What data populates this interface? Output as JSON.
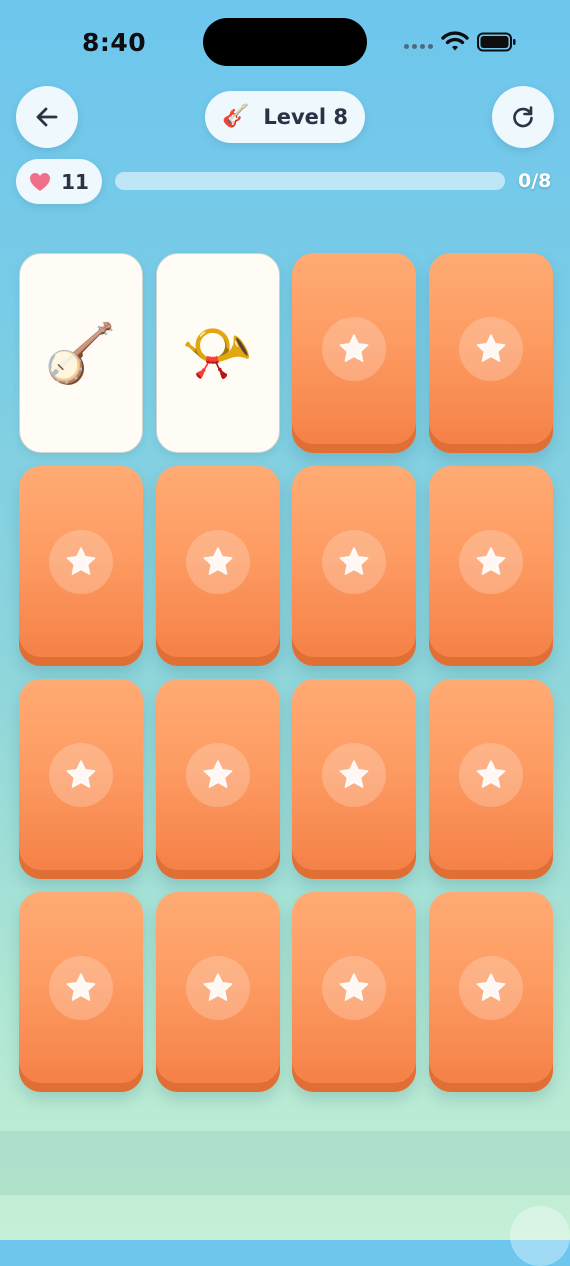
{
  "status": {
    "time": "8:40"
  },
  "header": {
    "level_label": "Level 8",
    "level_emoji": "🎸"
  },
  "lives": {
    "count": "11"
  },
  "progress": {
    "matched": 0,
    "total": 8,
    "label": "0/8"
  },
  "colors": {
    "card_back": "#fd9b62",
    "heart": "#f0708a",
    "accent": "#ff9a5c"
  },
  "cards": [
    {
      "state": "face-up",
      "emoji": "🪕",
      "name": "banjo"
    },
    {
      "state": "face-up",
      "emoji": "📯",
      "name": "postal-horn"
    },
    {
      "state": "face-down",
      "icon": "star-icon"
    },
    {
      "state": "face-down",
      "icon": "star-icon"
    },
    {
      "state": "face-down",
      "icon": "star-icon"
    },
    {
      "state": "face-down",
      "icon": "star-icon"
    },
    {
      "state": "face-down",
      "icon": "star-icon"
    },
    {
      "state": "face-down",
      "icon": "star-icon"
    },
    {
      "state": "face-down",
      "icon": "star-icon"
    },
    {
      "state": "face-down",
      "icon": "star-icon"
    },
    {
      "state": "face-down",
      "icon": "star-icon"
    },
    {
      "state": "face-down",
      "icon": "star-icon"
    },
    {
      "state": "face-down",
      "icon": "star-icon"
    },
    {
      "state": "face-down",
      "icon": "star-icon"
    },
    {
      "state": "face-down",
      "icon": "star-icon"
    },
    {
      "state": "face-down",
      "icon": "star-icon"
    }
  ]
}
